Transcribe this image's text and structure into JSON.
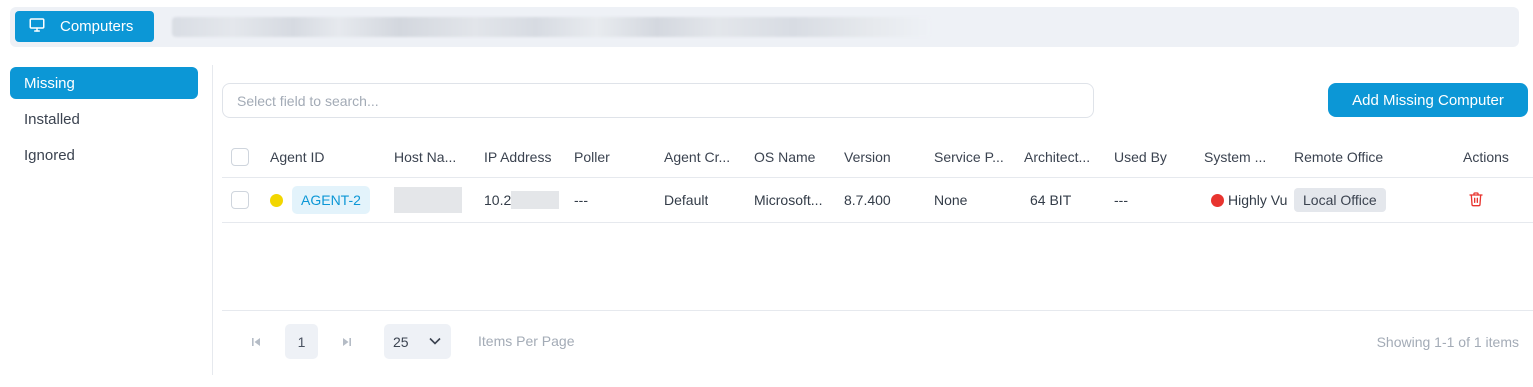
{
  "topbar": {
    "tab_label": "Computers",
    "tab_icon": "monitor-icon"
  },
  "leftnav": {
    "items": [
      {
        "label": "Missing",
        "active": true
      },
      {
        "label": "Installed",
        "active": false
      },
      {
        "label": "Ignored",
        "active": false
      }
    ]
  },
  "search": {
    "placeholder": "Select field to search...",
    "value": ""
  },
  "add_button": {
    "label": "Add Missing Computer"
  },
  "table": {
    "columns": [
      "Agent ID",
      "Host Na...",
      "IP Address",
      "Poller",
      "Agent Cr...",
      "OS Name",
      "Version",
      "Service P...",
      "Architect...",
      "Used By",
      "System ...",
      "Remote Office",
      "Actions"
    ],
    "rows": [
      {
        "status_color": "#f2d600",
        "agent_id": "AGENT-2",
        "host_name": "",
        "ip_address": "10.2",
        "poller": "---",
        "agent_created": "Default",
        "os_name": "Microsoft...",
        "version": "8.7.400",
        "service_pack": "None",
        "architecture": "64 BIT",
        "used_by": "---",
        "system_status_color": "#e8342f",
        "system_status": "Highly Vu",
        "remote_office": "Local Office",
        "action_icon": "trash-icon"
      }
    ]
  },
  "pagination": {
    "current_page": "1",
    "per_page": "25",
    "items_per_page_label": "Items Per Page",
    "showing": "Showing 1-1 of 1 items"
  },
  "colors": {
    "accent": "#0c97d6",
    "danger": "#e8342f"
  }
}
